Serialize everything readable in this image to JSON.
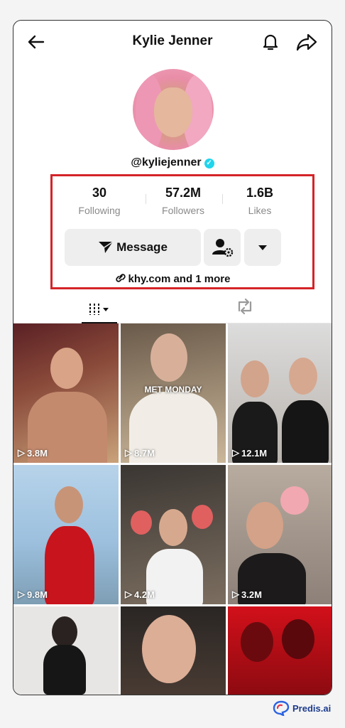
{
  "header": {
    "title": "Kylie Jenner"
  },
  "profile": {
    "handle": "@kyliejenner"
  },
  "stats": [
    {
      "value": "30",
      "label": "Following"
    },
    {
      "value": "57.2M",
      "label": "Followers"
    },
    {
      "value": "1.6B",
      "label": "Likes"
    }
  ],
  "actions": {
    "message_label": "Message"
  },
  "bio_link": "khy.com and 1 more",
  "videos": [
    {
      "views": "3.8M",
      "overlay": ""
    },
    {
      "views": "8.7M",
      "overlay": "MET MONDAY"
    },
    {
      "views": "12.1M",
      "overlay": ""
    },
    {
      "views": "9.8M",
      "overlay": ""
    },
    {
      "views": "4.2M",
      "overlay": ""
    },
    {
      "views": "3.2M",
      "overlay": ""
    },
    {
      "views": "",
      "overlay": ""
    },
    {
      "views": "",
      "overlay": ""
    },
    {
      "views": "",
      "overlay": ""
    }
  ],
  "brand": {
    "name": "Predis.ai"
  },
  "colors": {
    "highlight": "#d42428",
    "verified": "#20d5ec",
    "brand": "#1b3a8c"
  }
}
